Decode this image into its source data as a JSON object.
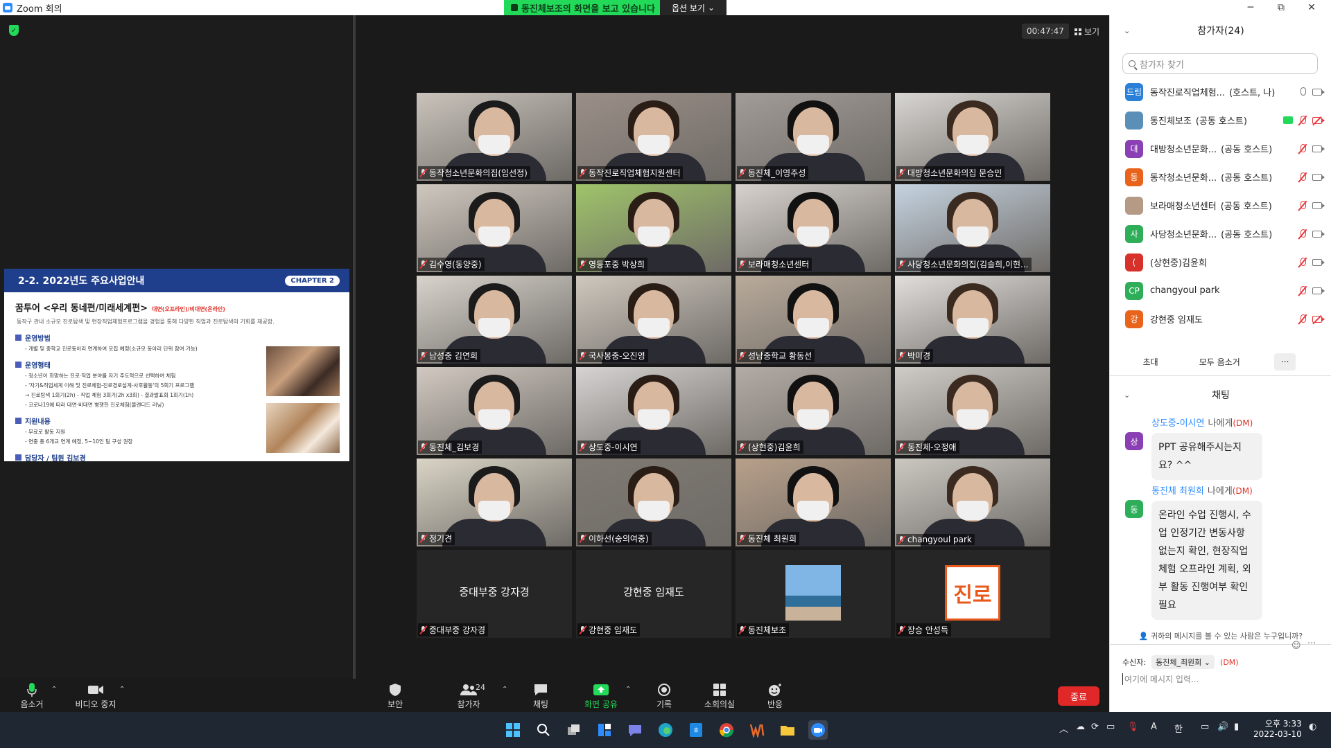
{
  "window": {
    "title": "Zoom 회의",
    "minimize": "─",
    "maximize": "⧉",
    "close": "✕"
  },
  "share_banner": {
    "text": "동진체보조의 화면을 보고 있습니다",
    "view_options": "옵션 보기"
  },
  "slide": {
    "title": "2-2. 2022년도 주요사업안내",
    "chapter": "CHAPTER 2",
    "subtitle": "꿈투어 <우리 동네편/미래세계편>",
    "subtitle_note": "대면(오프라인)/비대면(온라인)",
    "description": "동작구 관내 소규모 진로탐색 및 현장직업체험프로그램을 경험을 통해 다양한 직업과 진로탐색의 기회를 제공함.",
    "sections": [
      {
        "heading": "운영방법",
        "lines": [
          "- 개별 및 중학교 진로동아리 연계하여 모집 예정(소규모 동아리 단위 참여 가능)"
        ]
      },
      {
        "heading": "운영형태",
        "lines": [
          "- 청소년이 희망하는 진로·직업 분야를 자기 주도적으로 선택하여 체험",
          "- '자기&직업세계 이해 및 진로체험-진로경로설계-사후활동'의 5회기 프로그램",
          "  → 진로탐색 1회기(2h) - 직업 체험 3회기(2h x3회) - 결과발표회 1회기(1h)",
          "- 코로나19에 따라 대면·비대면 병행한 진로체험(블렌디드 러닝)"
        ]
      },
      {
        "heading": "지원내용",
        "lines": [
          "- 무료로 활동 지원",
          "- 연중 총 6개교 연계 예정, 5~10인 팀 구성 권장"
        ]
      },
      {
        "heading": "담당자 / 팀원 김보경",
        "lines": []
      }
    ]
  },
  "gallery": {
    "timer": "00:47:47",
    "view_label": "보기",
    "tiles": [
      {
        "name": "동작청소년문화의집(임선정)",
        "bg": "#c9c3bb"
      },
      {
        "name": "동작진로직업체험지원센터",
        "bg": "#9b8f88",
        "active": true
      },
      {
        "name": "동진체_이영주성",
        "bg": "#a29c98"
      },
      {
        "name": "대방청소년문화의집 문승민",
        "bg": "#d8d6d2"
      },
      {
        "name": "김수영(동양중)",
        "bg": "#cfc8bf"
      },
      {
        "name": "영등포중 박상희",
        "bg": "#9fc46a"
      },
      {
        "name": "보라매청소년센터",
        "bg": "#d7d2cd"
      },
      {
        "name": "사당청소년문화의집(김슬희,이현...",
        "bg": "#c5d3e0"
      },
      {
        "name": "남성중 김연희",
        "bg": "#d8d3cc"
      },
      {
        "name": "국사봉중-오진영",
        "bg": "#cfc8be"
      },
      {
        "name": "성남중학교 황동선",
        "bg": "#b9ab9b"
      },
      {
        "name": "박미경",
        "bg": "#e1dedb"
      },
      {
        "name": "동진체_김보경",
        "bg": "#d1c9c1"
      },
      {
        "name": "상도중-이시연",
        "bg": "#d6d4d2"
      },
      {
        "name": "(상현중)김윤희",
        "bg": "#b3aba5"
      },
      {
        "name": "동진체-오정애",
        "bg": "#cfcbc6"
      },
      {
        "name": "정기견",
        "bg": "#d9d4c5"
      },
      {
        "name": "이하선(숭의여중)",
        "bg": "#7f7a73"
      },
      {
        "name": "동진체 최원희",
        "bg": "#b8a08a"
      },
      {
        "name": "changyoul park",
        "bg": "#cbc7c1"
      },
      {
        "name": "중대부중 강자경",
        "big": "중대부중 강자경"
      },
      {
        "name": "강현중 임재도",
        "big": "강현중 임재도"
      },
      {
        "name": "동진체보조",
        "image": "photo"
      },
      {
        "name": "장승 안성득",
        "image": "logo",
        "logo_text": "진로"
      }
    ]
  },
  "toolbar": {
    "mute": "음소거",
    "video": "비디오 중지",
    "security": "보안",
    "participants": "참가자",
    "participants_count": "24",
    "chat": "채팅",
    "share": "화면 공유",
    "record": "기록",
    "breakout": "소회의실",
    "reactions": "반응",
    "end": "종료"
  },
  "participants_panel": {
    "title": "참가자(24)",
    "search_placeholder": "참가자 찾기",
    "list": [
      {
        "avatar": "드림",
        "color": "#2a7fd8",
        "name": "동작진로직업체험...",
        "role": "(호스트, 나)",
        "mic": "on",
        "video": "on"
      },
      {
        "avatar": "",
        "color": "#5a8fb8",
        "name": "동진체보조",
        "role": "(공동 호스트)",
        "mic": "off",
        "video": "off",
        "sharing": true
      },
      {
        "avatar": "대",
        "color": "#8a3fb5",
        "name": "대방청소년문화...",
        "role": "(공동 호스트)",
        "mic": "off",
        "video": "on"
      },
      {
        "avatar": "동",
        "color": "#e8641c",
        "name": "동작청소년문화...",
        "role": "(공동 호스트)",
        "mic": "off",
        "video": "on"
      },
      {
        "avatar": "",
        "color": "#b59a86",
        "name": "보라매청소년센터",
        "role": "(공동 호스트)",
        "mic": "off",
        "video": "on"
      },
      {
        "avatar": "사",
        "color": "#2fae5a",
        "name": "사당청소년문화...",
        "role": "(공동 호스트)",
        "mic": "off",
        "video": "on"
      },
      {
        "avatar": "(",
        "color": "#d8302a",
        "name": "(상현중)김윤희",
        "role": "",
        "mic": "off",
        "video": "on"
      },
      {
        "avatar": "CP",
        "color": "#2fae5a",
        "name": "changyoul park",
        "role": "",
        "mic": "off",
        "video": "on"
      },
      {
        "avatar": "강",
        "color": "#e8641c",
        "name": "강현중 임재도",
        "role": "",
        "mic": "off",
        "video": "off"
      }
    ],
    "buttons": {
      "invite": "초대",
      "mute_all": "모두 음소거",
      "more": "..."
    }
  },
  "chat": {
    "title": "채팅",
    "messages": [
      {
        "from": "상도중-이시연",
        "to": "나에게",
        "dm": "(DM)",
        "avatar": "상",
        "color": "#8a3fb5",
        "text": "PPT 공유해주시는지요? ^^"
      },
      {
        "from": "동진체 최원희",
        "to": "나에게",
        "dm": "(DM)",
        "avatar": "동",
        "color": "#2fae5a",
        "text": "온라인 수업 진행시, 수업 인정기간 변동사항 없는지 확인, 현장직업체험 오프라인 계획, 외부 활동 진행여부 확인 필요"
      }
    ],
    "who_can_see": "귀하의 메시지를 볼 수 있는 사람은 누구입니까?",
    "recipient_label": "수신자:",
    "recipient": "동진체_최원희",
    "recipient_dm": "(DM)",
    "input_placeholder": "여기에 메시지 입력..."
  },
  "taskbar": {
    "ime": "A",
    "lang": "한",
    "time": "오후 3:33",
    "date": "2022-03-10"
  }
}
